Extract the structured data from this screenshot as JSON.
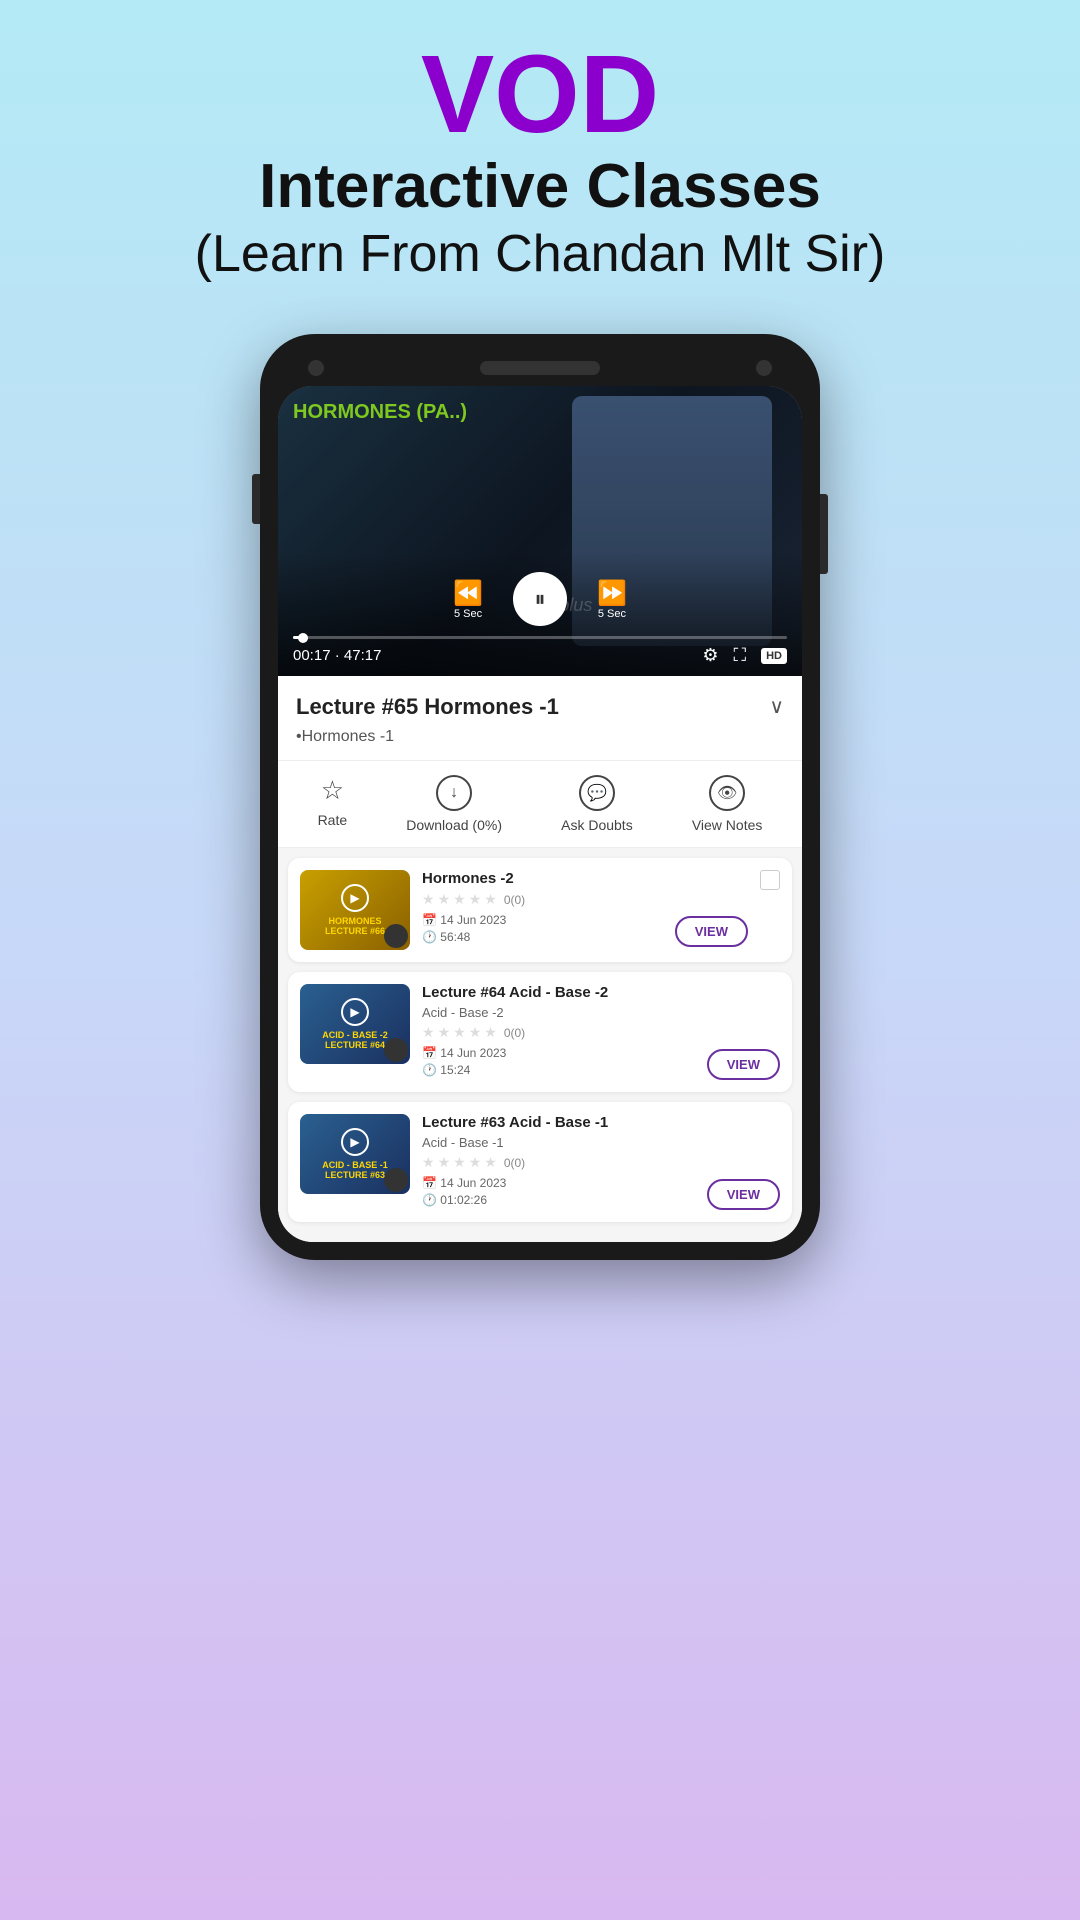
{
  "header": {
    "vod_label": "VOD",
    "subtitle1": "Interactive Classes",
    "subtitle2": "(Learn From Chandan Mlt Sir)"
  },
  "video": {
    "label": "HORMONES (PA..)",
    "watermark": "RanKplus",
    "time_current": "00:17",
    "time_total": "47:17",
    "time_separator": "·",
    "rewind_label": "5 Sec",
    "forward_label": "5 Sec",
    "quality": "HD"
  },
  "lecture": {
    "title": "Lecture #65 Hormones -1",
    "subtitle": "•Hormones -1"
  },
  "actions": [
    {
      "id": "rate",
      "icon": "☆",
      "label": "Rate"
    },
    {
      "id": "download",
      "icon": "↓",
      "label": "Download (0%)"
    },
    {
      "id": "ask-doubts",
      "icon": "💬",
      "label": "Ask Doubts"
    },
    {
      "id": "view-notes",
      "icon": "👁",
      "label": "View Notes"
    }
  ],
  "lectures": [
    {
      "id": "66",
      "thumb_label": "LECTURE #66",
      "thumb_bg": "hormones",
      "title": "Hormones -2",
      "subtitle": "",
      "rating": 0,
      "rating_count": "0(0)",
      "date": "14 Jun 2023",
      "duration": "56:48",
      "view_label": "VIEW"
    },
    {
      "id": "64",
      "thumb_label": "LECTURE #64",
      "thumb_bg": "acid2",
      "title": "Lecture #64 Acid - Base -2",
      "subtitle": "Acid - Base -2",
      "rating": 0,
      "rating_count": "0(0)",
      "date": "14 Jun 2023",
      "duration": "15:24",
      "view_label": "VIEW"
    },
    {
      "id": "63",
      "thumb_label": "LECTURE #63",
      "thumb_bg": "acid1",
      "title": "Lecture #63 Acid - Base -1",
      "subtitle": "Acid - Base -1",
      "rating": 0,
      "rating_count": "0(0)",
      "date": "14 Jun 2023",
      "duration": "01:02:26",
      "view_label": "VIEW"
    }
  ]
}
